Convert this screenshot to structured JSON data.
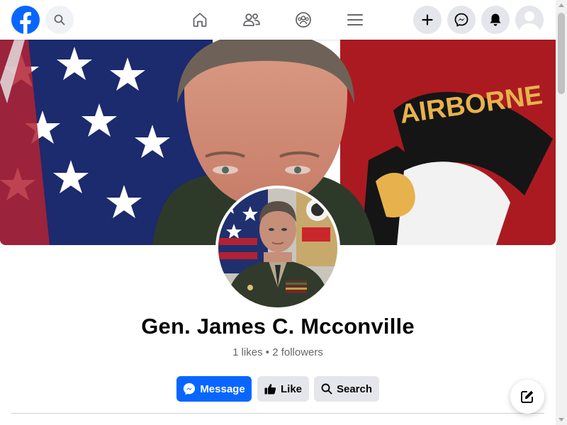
{
  "topbar": {
    "logo_icon": "facebook-logo-icon",
    "search_icon": "search-icon",
    "nav": [
      {
        "name": "home-icon"
      },
      {
        "name": "friends-icon"
      },
      {
        "name": "groups-icon"
      },
      {
        "name": "menu-icon"
      }
    ],
    "actions": [
      {
        "name": "create-icon"
      },
      {
        "name": "messenger-icon"
      },
      {
        "name": "notifications-icon"
      }
    ],
    "account_icon": "account-avatar-icon"
  },
  "cover": {
    "patch_text": "AIRBORNE"
  },
  "profile": {
    "name": "Gen. James C. Mcconville",
    "stats": "1 likes • 2 followers"
  },
  "buttons": {
    "message": "Message",
    "like": "Like",
    "search": "Search"
  },
  "compose_icon": "compose-icon",
  "colors": {
    "brand": "#0866ff",
    "button_gray": "#e4e6eb",
    "secondary_text": "#65676b"
  }
}
